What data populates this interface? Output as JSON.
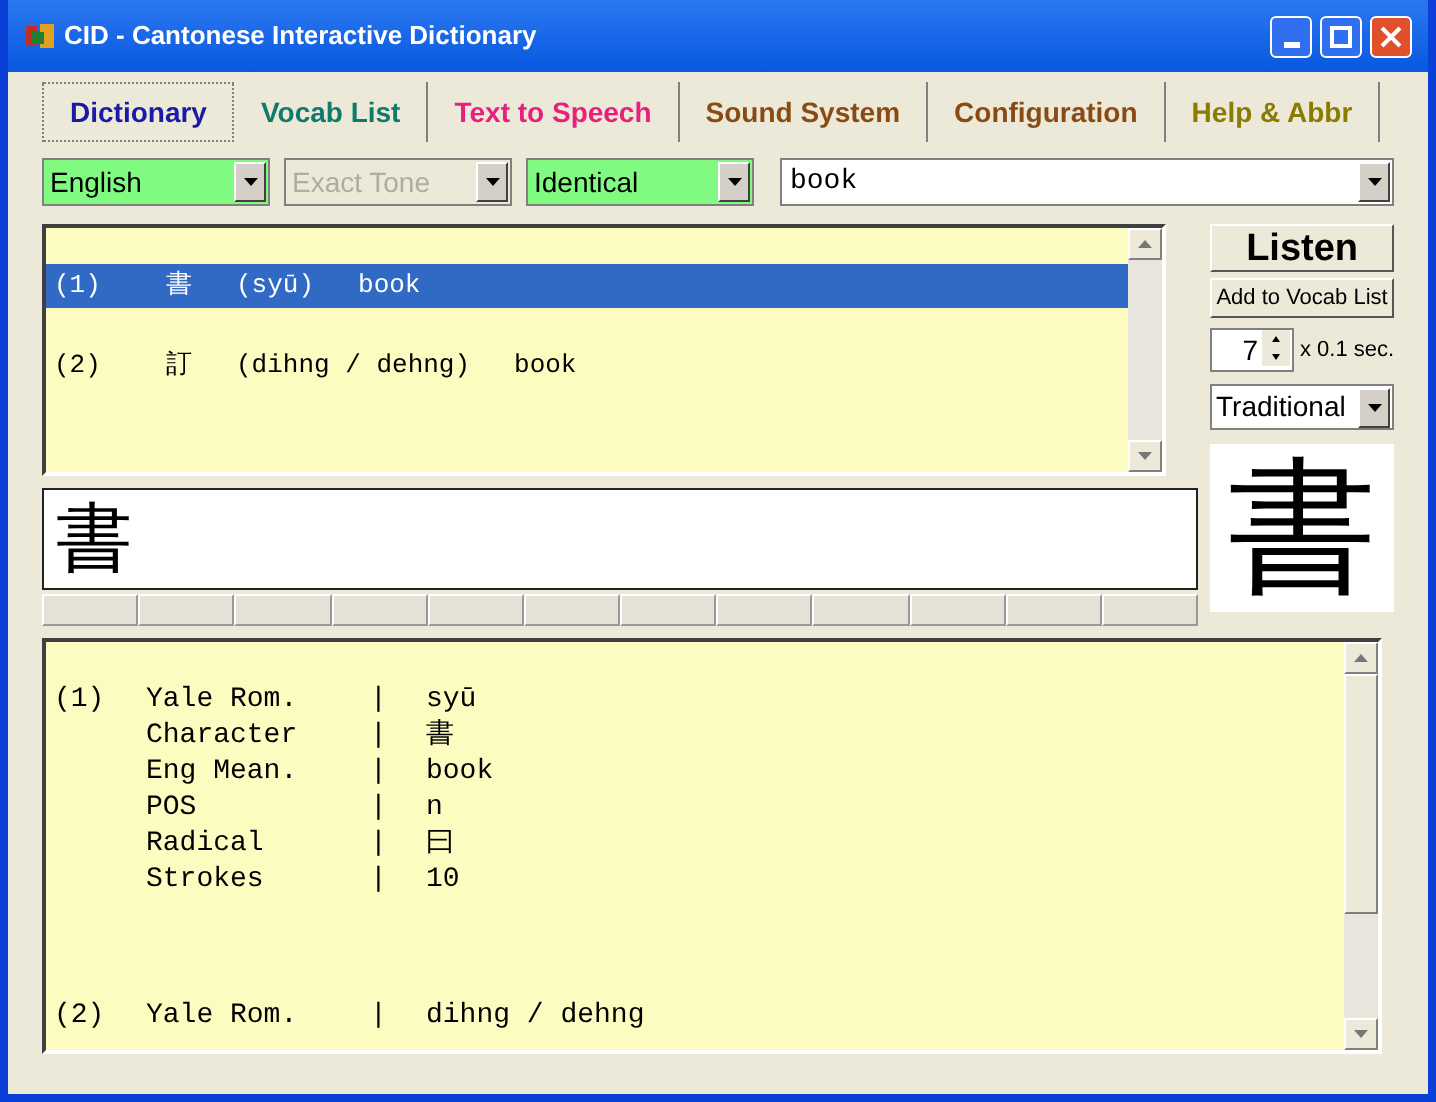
{
  "window": {
    "title": "CID - Cantonese Interactive Dictionary"
  },
  "tabs": [
    {
      "label": "Dictionary",
      "color": "#1a1aa8",
      "selected": true
    },
    {
      "label": "Vocab List",
      "color": "#127a6a",
      "selected": false
    },
    {
      "label": "Text to Speech",
      "color": "#e8207c",
      "selected": false
    },
    {
      "label": "Sound System",
      "color": "#8a4a14",
      "selected": false
    },
    {
      "label": "Configuration",
      "color": "#8a4a14",
      "selected": false
    },
    {
      "label": "Help & Abbr",
      "color": "#8a7c00",
      "selected": false
    }
  ],
  "filters": [
    {
      "value": "English",
      "highlighted": true,
      "disabled": false
    },
    {
      "value": "Exact Tone",
      "highlighted": false,
      "disabled": true
    },
    {
      "value": "Identical",
      "highlighted": true,
      "disabled": false
    }
  ],
  "search": {
    "value": "book"
  },
  "results": [
    {
      "number": "(1)",
      "character": "書",
      "romanization": "(syū)",
      "meaning": "book",
      "selected": true
    },
    {
      "number": "(2)",
      "character": "訂",
      "romanization": "(dihng / dehng)",
      "meaning": "book",
      "selected": false
    }
  ],
  "listen_button": "Listen",
  "add_button": "Add to Vocab List",
  "delay": {
    "value": "7",
    "unit": "x 0.1 sec."
  },
  "script_select": {
    "value": "Traditional"
  },
  "input_text": "書",
  "big_character": "書",
  "details": [
    {
      "number": "(1)",
      "fields": [
        {
          "label": "Yale Rom.",
          "sep": "|",
          "value": "syū"
        },
        {
          "label": "Character",
          "sep": "|",
          "value": "書"
        },
        {
          "label": "Eng Mean.",
          "sep": "|",
          "value": "book"
        },
        {
          "label": "POS",
          "sep": "|",
          "value": "n"
        },
        {
          "label": "Radical",
          "sep": "|",
          "value": "曰"
        },
        {
          "label": "Strokes",
          "sep": "|",
          "value": "10"
        }
      ]
    },
    {
      "number": "(2)",
      "fields": [
        {
          "label": "Yale Rom.",
          "sep": "|",
          "value": "dihng / dehng"
        }
      ]
    }
  ]
}
